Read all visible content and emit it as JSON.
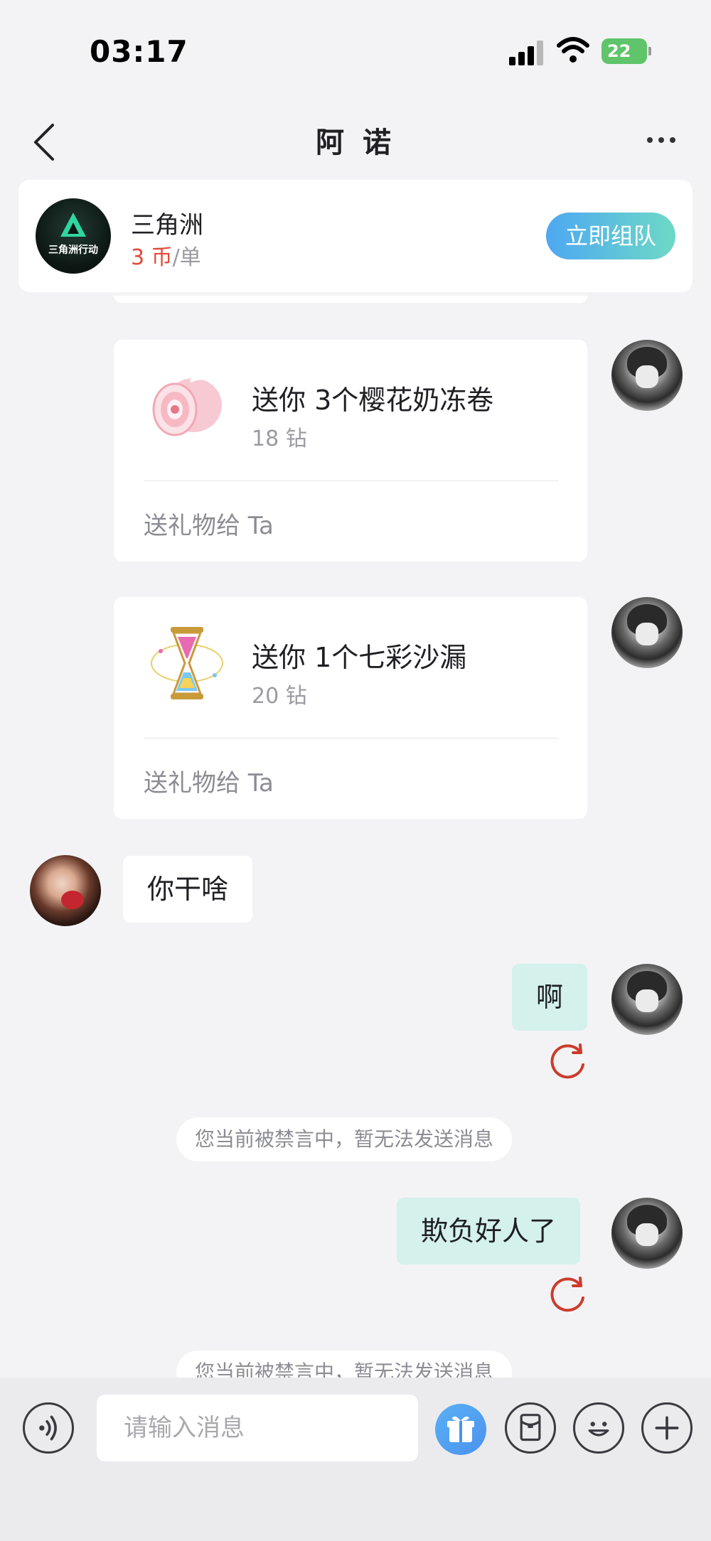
{
  "status_bar": {
    "time": "03:17",
    "battery": "22"
  },
  "nav": {
    "title": "阿 诺"
  },
  "game_card": {
    "name": "三角洲",
    "price_number": "3 币",
    "price_unit": "/单",
    "logo_text": "三角洲行动",
    "button_label": "立即组队"
  },
  "gifts": [
    {
      "title": "送你 3个樱花奶冻卷",
      "price": "18 钻",
      "action": "送礼物给 Ta"
    },
    {
      "title": "送你 1个七彩沙漏",
      "price": "20 钻",
      "action": "送礼物给 Ta"
    }
  ],
  "messages": [
    {
      "from": "other",
      "text": "你干啥"
    },
    {
      "from": "self",
      "text": "啊",
      "status": "failed"
    },
    {
      "from": "system",
      "text": "您当前被禁言中，暂无法发送消息"
    },
    {
      "from": "self",
      "text": "欺负好人了",
      "status": "failed"
    },
    {
      "from": "system",
      "text": "您当前被禁言中，暂无法发送消息"
    }
  ],
  "input": {
    "placeholder": "请输入消息"
  },
  "colors": {
    "accent_teal": "#d4f1ec",
    "price_red": "#e4483b",
    "retry_red": "#cc3b2b",
    "button_gradient_start": "#4da8f2",
    "button_gradient_end": "#6ed9c6"
  }
}
